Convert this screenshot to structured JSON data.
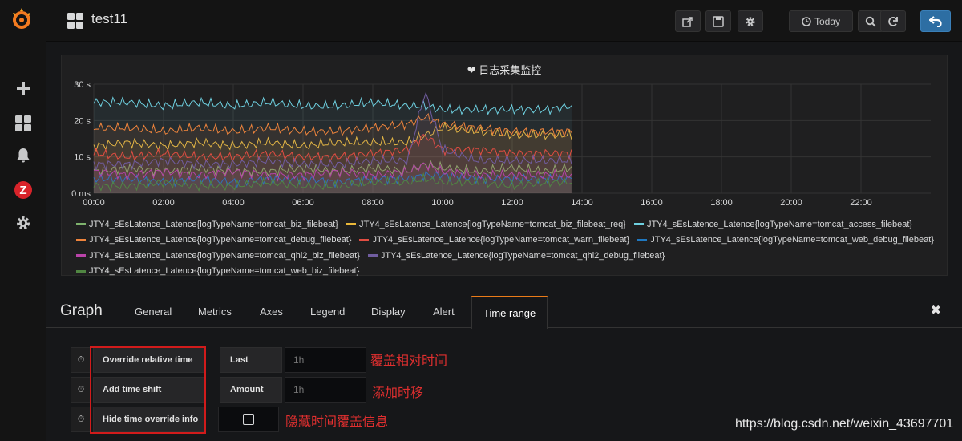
{
  "navbar": {
    "title": "test11",
    "today_label": "Today"
  },
  "sidemenu": {
    "icons": [
      "grafana-logo-icon",
      "plus-icon",
      "dashboards-icon",
      "bell-icon",
      "zabbix-icon",
      "gear-icon"
    ]
  },
  "panel": {
    "title": "日志采集监控",
    "legend": [
      {
        "name": "JTY4_sEsLatence_Latence{logTypeName=tomcat_biz_filebeat}",
        "color": "#7eb26d"
      },
      {
        "name": "JTY4_sEsLatence_Latence{logTypeName=tomcat_biz_filebeat_req}",
        "color": "#eab839"
      },
      {
        "name": "JTY4_sEsLatence_Latence{logTypeName=tomcat_access_filebeat}",
        "color": "#6ed0e0"
      },
      {
        "name": "JTY4_sEsLatence_Latence{logTypeName=tomcat_debug_filebeat}",
        "color": "#ef843c"
      },
      {
        "name": "JTY4_sEsLatence_Latence{logTypeName=tomcat_warn_filebeat}",
        "color": "#e24d42"
      },
      {
        "name": "JTY4_sEsLatence_Latence{logTypeName=tomcat_web_debug_filebeat}",
        "color": "#1f78c1"
      },
      {
        "name": "JTY4_sEsLatence_Latence{logTypeName=tomcat_qhl2_biz_filebeat}",
        "color": "#ba43a9"
      },
      {
        "name": "JTY4_sEsLatence_Latence{logTypeName=tomcat_qhl2_debug_filebeat}",
        "color": "#705da0"
      },
      {
        "name": "JTY4_sEsLatence_Latence{logTypeName=tomcat_web_biz_filebeat}",
        "color": "#508642"
      }
    ]
  },
  "chart_data": {
    "type": "line",
    "title": "日志采集监控",
    "xlabel": "",
    "ylabel": "",
    "x_ticks": [
      "00:00",
      "02:00",
      "04:00",
      "06:00",
      "08:00",
      "10:00",
      "12:00",
      "14:00",
      "16:00",
      "18:00",
      "20:00",
      "22:00"
    ],
    "y_ticks": [
      "0 ms",
      "10 s",
      "20 s",
      "30 s"
    ],
    "ylim": [
      0,
      30
    ],
    "xlim": [
      0,
      24
    ],
    "grid": true,
    "x": [
      0,
      1,
      2,
      3,
      4,
      5,
      6,
      7,
      8,
      9,
      9.5,
      10,
      11,
      12,
      13,
      13.7
    ],
    "series": [
      {
        "name": "JTY4_sEsLatence_Latence{logTypeName=tomcat_biz_filebeat}",
        "values": [
          6,
          7,
          6,
          7,
          6,
          6,
          7,
          6,
          7,
          6,
          8,
          7,
          6,
          7,
          6,
          7
        ]
      },
      {
        "name": "JTY4_sEsLatence_Latence{logTypeName=tomcat_biz_filebeat_req}",
        "values": [
          13,
          14,
          13,
          14,
          13,
          14,
          13,
          14,
          14,
          14,
          16,
          18,
          17,
          16,
          16,
          16
        ]
      },
      {
        "name": "JTY4_sEsLatence_Latence{logTypeName=tomcat_access_filebeat}",
        "values": [
          25,
          25,
          24,
          25,
          24,
          25,
          24,
          24,
          25,
          24,
          24,
          23,
          23,
          23,
          23,
          24
        ]
      },
      {
        "name": "JTY4_sEsLatence_Latence{logTypeName=tomcat_debug_filebeat}",
        "values": [
          18,
          18,
          17,
          18,
          17,
          18,
          17,
          17,
          18,
          19,
          21,
          19,
          18,
          17,
          17,
          17
        ]
      },
      {
        "name": "JTY4_sEsLatence_Latence{logTypeName=tomcat_warn_filebeat}",
        "values": [
          11,
          10,
          11,
          10,
          10,
          11,
          10,
          10,
          11,
          12,
          16,
          12,
          12,
          11,
          11,
          11
        ]
      },
      {
        "name": "JTY4_sEsLatence_Latence{logTypeName=tomcat_web_debug_filebeat}",
        "values": [
          4,
          4,
          3,
          4,
          3,
          4,
          4,
          3,
          4,
          4,
          5,
          5,
          4,
          4,
          4,
          4
        ]
      },
      {
        "name": "JTY4_sEsLatence_Latence{logTypeName=tomcat_qhl2_biz_filebeat}",
        "values": [
          6,
          5,
          6,
          5,
          6,
          5,
          5,
          6,
          5,
          6,
          8,
          6,
          5,
          5,
          5,
          5
        ]
      },
      {
        "name": "JTY4_sEsLatence_Latence{logTypeName=tomcat_qhl2_debug_filebeat}",
        "values": [
          8,
          8,
          9,
          8,
          8,
          9,
          8,
          8,
          9,
          9,
          28,
          12,
          9,
          9,
          9,
          9
        ]
      },
      {
        "name": "JTY4_sEsLatence_Latence{logTypeName=tomcat_web_biz_filebeat}",
        "values": [
          2,
          2,
          3,
          2,
          2,
          3,
          2,
          2,
          3,
          3,
          4,
          3,
          3,
          2,
          3,
          3
        ]
      }
    ]
  },
  "editor": {
    "title": "Graph",
    "tabs": [
      "General",
      "Metrics",
      "Axes",
      "Legend",
      "Display",
      "Alert",
      "Time range"
    ],
    "rows": {
      "override_label": "Override relative time",
      "last_label": "Last",
      "last_placeholder": "1h",
      "shift_label": "Add time shift",
      "amount_label": "Amount",
      "amount_placeholder": "1h",
      "hide_label": "Hide time override info"
    },
    "annotations": {
      "override": "覆盖相对时间",
      "shift": "添加时移",
      "hide": "隐藏时间覆盖信息"
    }
  },
  "watermark": "https://blog.csdn.net/weixin_43697701"
}
